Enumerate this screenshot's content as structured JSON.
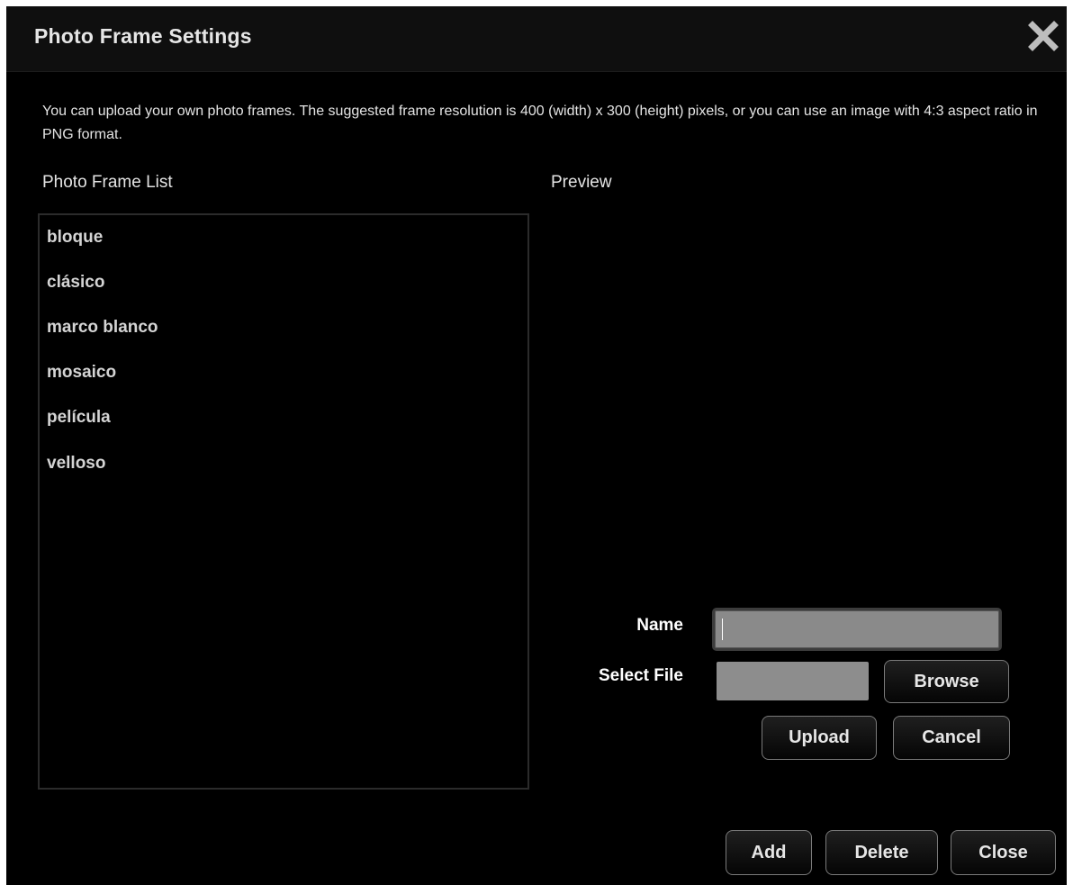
{
  "dialog": {
    "title": "Photo Frame Settings",
    "close_icon": "close-x-icon",
    "description": "You can upload your own photo frames. The suggested frame resolution is 400 (width) x 300 (height) pixels, or you can use an image with 4:3 aspect ratio in PNG format."
  },
  "frame_list": {
    "label": "Photo Frame List",
    "items": [
      {
        "label": "bloque"
      },
      {
        "label": "clásico"
      },
      {
        "label": "marco blanco"
      },
      {
        "label": "mosaico"
      },
      {
        "label": "película"
      },
      {
        "label": "velloso"
      }
    ]
  },
  "preview": {
    "label": "Preview"
  },
  "upload_form": {
    "name_label": "Name",
    "name_value": "",
    "select_file_label": "Select File",
    "browse_label": "Browse",
    "upload_label": "Upload",
    "cancel_label": "Cancel"
  },
  "footer": {
    "add_label": "Add",
    "delete_label": "Delete",
    "close_label": "Close"
  },
  "colors": {
    "background": "#000000",
    "titlebar": "#0f0f0f",
    "text": "#e4e4e4",
    "input_fill": "#8a8a8a",
    "button_border": "#7a7a7a"
  }
}
